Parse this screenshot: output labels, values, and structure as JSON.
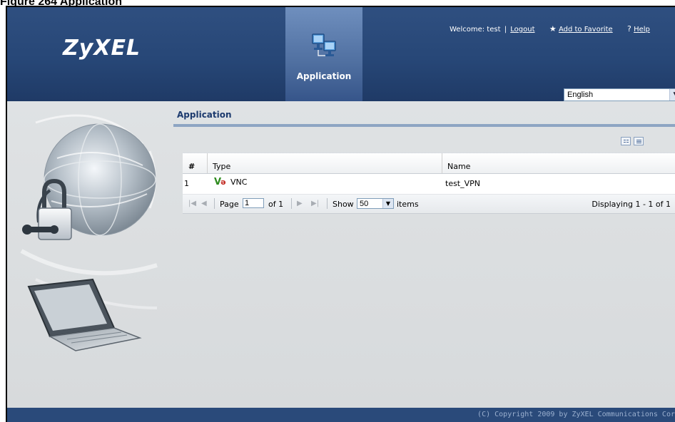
{
  "figure_caption": "Figure 264   Application",
  "header": {
    "logo": "ZyXEL",
    "active_tab": "Application",
    "welcome_prefix": "Welcome: test",
    "separator": "|",
    "logout": "Logout",
    "add_favorite": "Add to Favorite",
    "help": "Help",
    "language": "English"
  },
  "main": {
    "title": "Application",
    "table": {
      "columns": [
        "#",
        "Type",
        "Name"
      ],
      "rows": [
        {
          "num": "1",
          "type_icon": "Və",
          "type": "VNC",
          "name": "test_VPN"
        }
      ]
    },
    "pager": {
      "page_label": "Page",
      "page_value": "1",
      "of_label": "of 1",
      "show_label": "Show",
      "show_value": "50",
      "items_label": "items",
      "displaying": "Displaying 1 - 1 of 1"
    }
  },
  "footer": {
    "copyright": "(C) Copyright 2009 by ZyXEL Communications Cor"
  },
  "colors": {
    "header_bg": "#274777",
    "active_tab_bg": "#5b7bad",
    "content_bg": "#dcdfe1",
    "title_text": "#1c3a6e",
    "vnc_green": "#2e8b1e",
    "vnc_red": "#c0261e"
  }
}
